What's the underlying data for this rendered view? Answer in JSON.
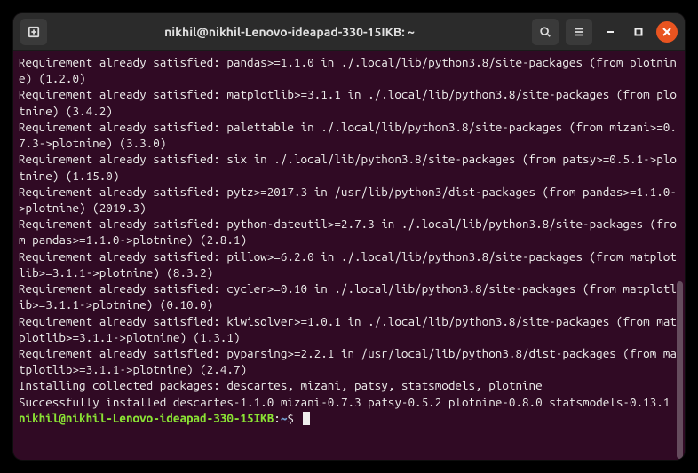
{
  "titlebar": {
    "title": "nikhil@nikhil-Lenovo-ideapad-330-15IKB: ~"
  },
  "terminal": {
    "lines": "Requirement already satisfied: pandas>=1.1.0 in ./.local/lib/python3.8/site-packages (from plotnine) (1.2.0)\nRequirement already satisfied: matplotlib>=3.1.1 in ./.local/lib/python3.8/site-packages (from plotnine) (3.4.2)\nRequirement already satisfied: palettable in ./.local/lib/python3.8/site-packages (from mizani>=0.7.3->plotnine) (3.3.0)\nRequirement already satisfied: six in ./.local/lib/python3.8/site-packages (from patsy>=0.5.1->plotnine) (1.15.0)\nRequirement already satisfied: pytz>=2017.3 in /usr/lib/python3/dist-packages (from pandas>=1.1.0->plotnine) (2019.3)\nRequirement already satisfied: python-dateutil>=2.7.3 in ./.local/lib/python3.8/site-packages (from pandas>=1.1.0->plotnine) (2.8.1)\nRequirement already satisfied: pillow>=6.2.0 in ./.local/lib/python3.8/site-packages (from matplotlib>=3.1.1->plotnine) (8.3.2)\nRequirement already satisfied: cycler>=0.10 in ./.local/lib/python3.8/site-packages (from matplotlib>=3.1.1->plotnine) (0.10.0)\nRequirement already satisfied: kiwisolver>=1.0.1 in ./.local/lib/python3.8/site-packages (from matplotlib>=3.1.1->plotnine) (1.3.1)\nRequirement already satisfied: pyparsing>=2.2.1 in /usr/local/lib/python3.8/dist-packages (from matplotlib>=3.1.1->plotnine) (2.4.7)\nInstalling collected packages: descartes, mizani, patsy, statsmodels, plotnine\nSuccessfully installed descartes-1.1.0 mizani-0.7.3 patsy-0.5.2 plotnine-0.8.0 statsmodels-0.13.1",
    "prompt": {
      "userhost": "nikhil@nikhil-Lenovo-ideapad-330-15IKB",
      "colon": ":",
      "path": "~",
      "symbol": "$"
    }
  }
}
